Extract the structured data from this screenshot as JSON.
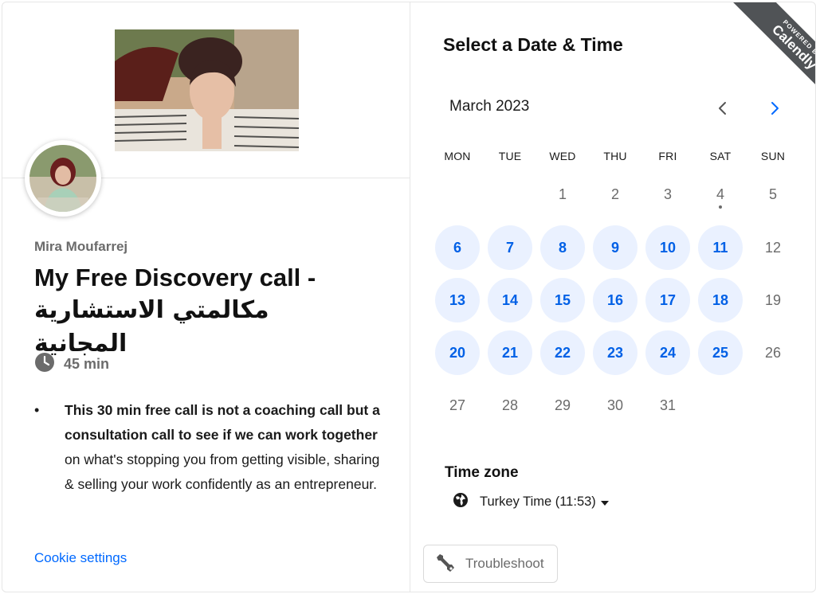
{
  "profile": {
    "host_name": "Mira Moufarrej",
    "event_title": "My Free Discovery call -",
    "event_title_arabic": "مكالمتي الاستشارية المجانية",
    "duration": "45 min"
  },
  "description": {
    "bold_1": "This 30 min free call is not a coaching call but a consultation call to see if we can work together",
    "rest": " on what's stopping you from getting visible, sharing & selling your work confidently as an entrepreneur."
  },
  "footer": {
    "cookie_settings": "Cookie settings"
  },
  "calendar": {
    "heading": "Select a Date & Time",
    "month_label": "March 2023",
    "weekdays": [
      "MON",
      "TUE",
      "WED",
      "THU",
      "FRI",
      "SAT",
      "SUN"
    ],
    "weeks": [
      [
        null,
        null,
        {
          "d": "1"
        },
        {
          "d": "2"
        },
        {
          "d": "3"
        },
        {
          "d": "4",
          "dot": true
        },
        {
          "d": "5"
        }
      ],
      [
        {
          "d": "6",
          "a": true
        },
        {
          "d": "7",
          "a": true
        },
        {
          "d": "8",
          "a": true
        },
        {
          "d": "9",
          "a": true
        },
        {
          "d": "10",
          "a": true
        },
        {
          "d": "11",
          "a": true
        },
        {
          "d": "12"
        }
      ],
      [
        {
          "d": "13",
          "a": true
        },
        {
          "d": "14",
          "a": true
        },
        {
          "d": "15",
          "a": true
        },
        {
          "d": "16",
          "a": true
        },
        {
          "d": "17",
          "a": true
        },
        {
          "d": "18",
          "a": true
        },
        {
          "d": "19"
        }
      ],
      [
        {
          "d": "20",
          "a": true
        },
        {
          "d": "21",
          "a": true
        },
        {
          "d": "22",
          "a": true
        },
        {
          "d": "23",
          "a": true
        },
        {
          "d": "24",
          "a": true
        },
        {
          "d": "25",
          "a": true
        },
        {
          "d": "26"
        }
      ],
      [
        {
          "d": "27"
        },
        {
          "d": "28"
        },
        {
          "d": "29"
        },
        {
          "d": "30"
        },
        {
          "d": "31"
        },
        null,
        null
      ]
    ]
  },
  "timezone": {
    "label": "Time zone",
    "value": "Turkey Time (11:53)"
  },
  "troubleshoot": {
    "label": "Troubleshoot"
  },
  "badge": {
    "line1": "POWERED BY",
    "line2": "Calendly"
  },
  "colors": {
    "accent": "#0069ff",
    "available_bg": "#eaf1ff",
    "badge_bg": "#505356"
  },
  "icons": [
    "clock-icon",
    "globe-icon",
    "chevron-left-icon",
    "chevron-right-icon",
    "caret-down-icon",
    "wrench-icon"
  ]
}
